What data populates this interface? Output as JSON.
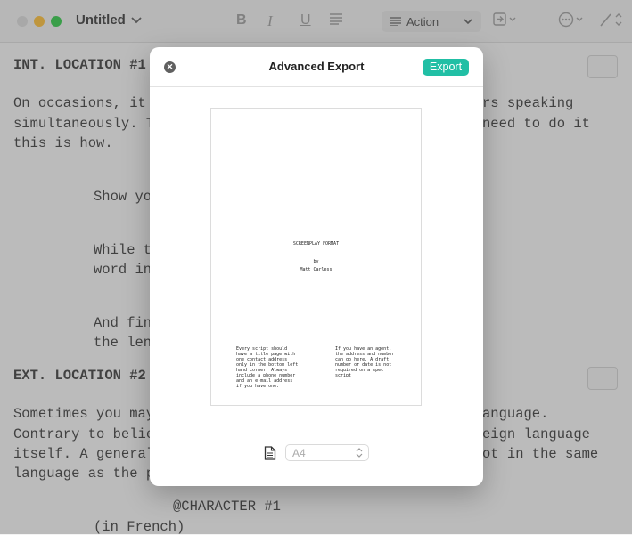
{
  "window": {
    "doc_title": "Untitled",
    "toolbar": {
      "bold": "B",
      "italic": "I",
      "underline": "U",
      "element_type": "Action"
    }
  },
  "editor": {
    "lines": [
      "INT. LOCATION #1",
      "On occasions, it",
      "rs speaking",
      "simultaneously. T",
      "need to do it",
      "this is how.",
      "Show yo",
      "While t",
      "word in",
      "And fin",
      "the len",
      "EXT. LOCATION #2",
      "Sometimes you may",
      "anguage.",
      "Contrary to belie",
      "eign language",
      "itself. A general",
      "ot in the same",
      "language as the p",
      "@CHARACTER #1",
      "(in French)"
    ]
  },
  "modal": {
    "title": "Advanced Export",
    "export_label": "Export",
    "preview": {
      "title": "SCREENPLAY FORMAT",
      "by": "by",
      "author": "Matt Carless",
      "left_note": "Every script should\nhave a title page with\none contact address\nonly in the bottom left\nhand corner. Always\ninclude a phone number\nand an e-mail address\nif you have one.",
      "right_note": "If you have an agent,\nthe address and number\ncan go here. A draft\nnumber or date is not\nrequired on a spec\nscript"
    },
    "page_size": "A4"
  },
  "colors": {
    "accent": "#21bfa5",
    "traffic_min": "#febc2e",
    "traffic_max": "#28c840"
  }
}
